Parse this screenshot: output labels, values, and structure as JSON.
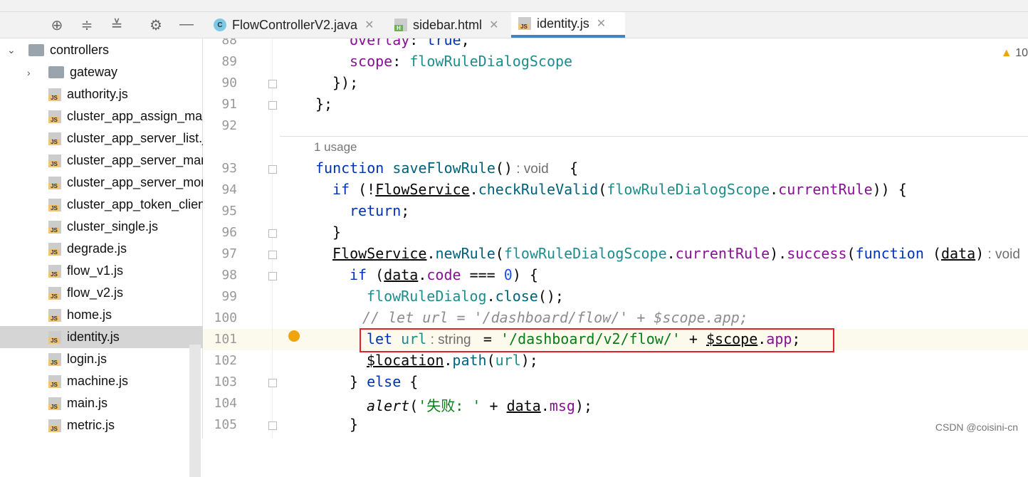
{
  "toolbar": {
    "icons": [
      "crosshair-icon",
      "expand-all-icon",
      "collapse-all-icon",
      "gear-icon",
      "minimize-icon"
    ]
  },
  "tabs": [
    {
      "label": "FlowControllerV2.java",
      "icon": "C",
      "type": "java"
    },
    {
      "label": "sidebar.html",
      "icon": "H",
      "type": "html"
    },
    {
      "label": "identity.js",
      "icon": "JS",
      "type": "js",
      "active": true
    }
  ],
  "sidebar": {
    "items": [
      {
        "label": "controllers",
        "kind": "folder",
        "expanded": true
      },
      {
        "label": "gateway",
        "kind": "folder",
        "expanded": false
      },
      {
        "label": "authority.js",
        "kind": "js"
      },
      {
        "label": "cluster_app_assign_manage.js",
        "kind": "js"
      },
      {
        "label": "cluster_app_server_list.js",
        "kind": "js"
      },
      {
        "label": "cluster_app_server_manage.js",
        "kind": "js"
      },
      {
        "label": "cluster_app_server_monitor.js",
        "kind": "js"
      },
      {
        "label": "cluster_app_token_client.js",
        "kind": "js"
      },
      {
        "label": "cluster_single.js",
        "kind": "js"
      },
      {
        "label": "degrade.js",
        "kind": "js"
      },
      {
        "label": "flow_v1.js",
        "kind": "js"
      },
      {
        "label": "flow_v2.js",
        "kind": "js"
      },
      {
        "label": "home.js",
        "kind": "js"
      },
      {
        "label": "identity.js",
        "kind": "js",
        "selected": true
      },
      {
        "label": "login.js",
        "kind": "js"
      },
      {
        "label": "machine.js",
        "kind": "js"
      },
      {
        "label": "main.js",
        "kind": "js"
      },
      {
        "label": "metric.js",
        "kind": "js"
      }
    ]
  },
  "editor": {
    "warning_count": "10",
    "usage_hint": "1 usage",
    "lines": [
      {
        "n": "88",
        "indent": 2,
        "t": [
          [
            "prop",
            "overlay"
          ],
          [
            "",
            ": "
          ],
          [
            "kw",
            "true"
          ],
          [
            "",
            ","
          ]
        ]
      },
      {
        "n": "89",
        "indent": 2,
        "t": [
          [
            "prop",
            "scope"
          ],
          [
            "",
            ": "
          ],
          [
            "var",
            "flowRuleDialogScope"
          ]
        ]
      },
      {
        "n": "90",
        "indent": 1,
        "t": [
          [
            "",
            "});"
          ]
        ]
      },
      {
        "n": "91",
        "indent": 0,
        "t": [
          [
            "",
            "};"
          ]
        ]
      },
      {
        "n": "92",
        "indent": 0,
        "t": []
      },
      {
        "n": "93",
        "indent": 0,
        "t": [
          [
            "kw",
            "function "
          ],
          [
            "fn",
            "saveFlowRule"
          ],
          [
            "",
            "()"
          ],
          [
            "hint",
            " : void "
          ],
          [
            "",
            "  {"
          ]
        ]
      },
      {
        "n": "94",
        "indent": 1,
        "t": [
          [
            "kw",
            "if "
          ],
          [
            "",
            "(!"
          ],
          [
            "und",
            "FlowService"
          ],
          [
            "",
            "."
          ],
          [
            "fn",
            "checkRuleValid"
          ],
          [
            "",
            "("
          ],
          [
            "var",
            "flowRuleDialogScope"
          ],
          [
            "",
            "."
          ],
          [
            "prop",
            "currentRule"
          ],
          [
            "",
            ")) {"
          ]
        ]
      },
      {
        "n": "95",
        "indent": 2,
        "t": [
          [
            "kw",
            "return"
          ],
          [
            "",
            ";"
          ]
        ]
      },
      {
        "n": "96",
        "indent": 1,
        "t": [
          [
            "",
            "}"
          ]
        ]
      },
      {
        "n": "97",
        "indent": 1,
        "t": [
          [
            "und",
            "FlowService"
          ],
          [
            "",
            "."
          ],
          [
            "fn",
            "newRule"
          ],
          [
            "",
            "("
          ],
          [
            "var",
            "flowRuleDialogScope"
          ],
          [
            "",
            "."
          ],
          [
            "prop",
            "currentRule"
          ],
          [
            "",
            ")."
          ],
          [
            "prop",
            "success"
          ],
          [
            "",
            "("
          ],
          [
            "kw",
            "function "
          ],
          [
            "",
            "("
          ],
          [
            "und",
            "data"
          ],
          [
            "",
            ")"
          ],
          [
            "hint",
            " : void"
          ]
        ]
      },
      {
        "n": "98",
        "indent": 2,
        "t": [
          [
            "kw",
            "if "
          ],
          [
            "",
            "("
          ],
          [
            "und",
            "data"
          ],
          [
            "",
            "."
          ],
          [
            "prop",
            "code"
          ],
          [
            "",
            " === "
          ],
          [
            "num",
            "0"
          ],
          [
            "",
            ") {"
          ]
        ]
      },
      {
        "n": "99",
        "indent": 3,
        "t": [
          [
            "var",
            "flowRuleDialog"
          ],
          [
            "",
            "."
          ],
          [
            "fn",
            "close"
          ],
          [
            "",
            "();"
          ]
        ]
      },
      {
        "n": "100",
        "indent": 2.75,
        "t": [
          [
            "cm",
            "// let url = '/dashboard/flow/' + $scope.app;"
          ]
        ]
      },
      {
        "n": "101",
        "indent": 3,
        "current": true,
        "t": [
          [
            "kw",
            "let "
          ],
          [
            "var",
            "url"
          ],
          [
            "hint",
            " : string "
          ],
          [
            "",
            " = "
          ],
          [
            "str",
            "'/dashboard/v2/flow/'"
          ],
          [
            "",
            " + "
          ],
          [
            "und",
            "$scope"
          ],
          [
            "",
            "."
          ],
          [
            "prop",
            "app"
          ],
          [
            "",
            ";"
          ]
        ]
      },
      {
        "n": "102",
        "indent": 3,
        "t": [
          [
            "und",
            "$location"
          ],
          [
            "",
            "."
          ],
          [
            "fn",
            "path"
          ],
          [
            "",
            "("
          ],
          [
            "var",
            "url"
          ],
          [
            "",
            ");"
          ]
        ]
      },
      {
        "n": "103",
        "indent": 2,
        "t": [
          [
            "",
            "} "
          ],
          [
            "kw",
            "else"
          ],
          [
            "",
            " {"
          ]
        ]
      },
      {
        "n": "104",
        "indent": 3,
        "t": [
          [
            "it",
            "alert"
          ],
          [
            "",
            "("
          ],
          [
            "str",
            "'失败: '"
          ],
          [
            "",
            " + "
          ],
          [
            "und",
            "data"
          ],
          [
            "",
            "."
          ],
          [
            "prop",
            "msg"
          ],
          [
            "",
            ");"
          ]
        ]
      },
      {
        "n": "105",
        "indent": 2,
        "t": [
          [
            "",
            "}"
          ]
        ]
      }
    ]
  },
  "watermark": "CSDN @coisini-cn",
  "colors": {
    "accent": "#4083c9",
    "highlight_box": "#e0232b",
    "selected_row": "#d5d5d5"
  }
}
